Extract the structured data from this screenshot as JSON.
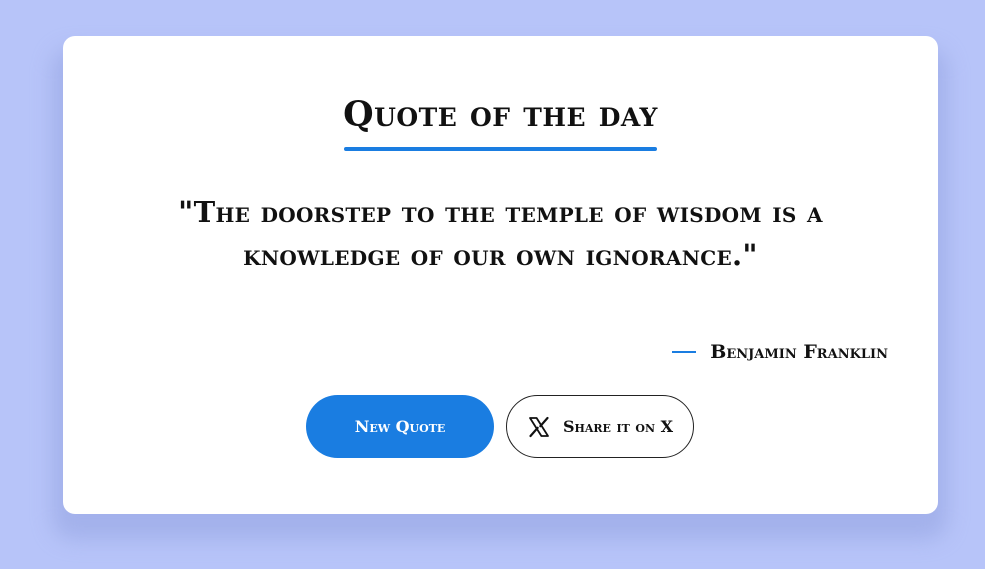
{
  "header": {
    "title": "Quote of the day"
  },
  "quote": {
    "text": "\"The doorstep to the temple of wisdom is a knowledge of our own ignorance.\"",
    "author": "Benjamin Franklin"
  },
  "actions": {
    "new_quote_label": "New Quote",
    "share_label": "Share it on X"
  },
  "icons": {
    "share": "x-logo-icon"
  },
  "colors": {
    "accent": "#1a7de1",
    "background": "#b7c4f9",
    "card": "#ffffff",
    "text": "#111111"
  }
}
